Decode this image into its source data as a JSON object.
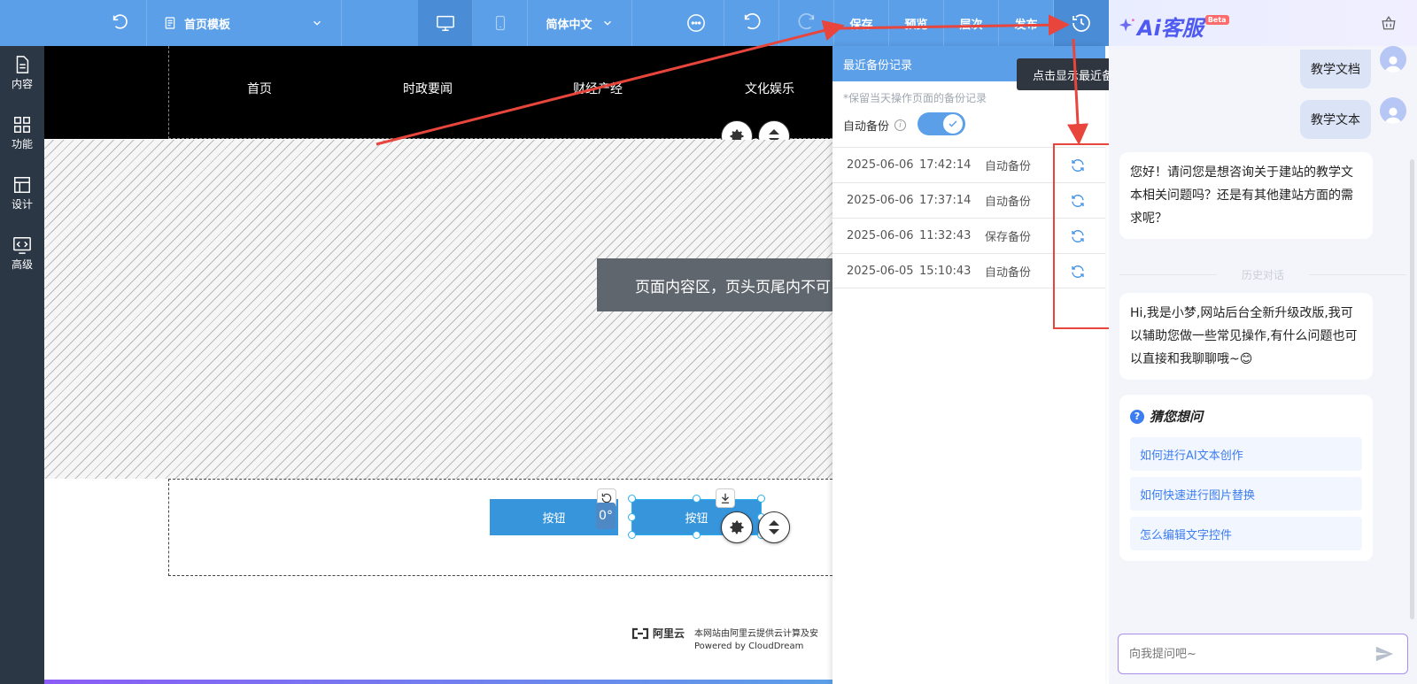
{
  "toolbar": {
    "template_name": "首页模板",
    "language": "简体中文",
    "save": "保存",
    "preview": "预览",
    "layer": "层次",
    "publish": "发布"
  },
  "sidebar": {
    "items": [
      {
        "label": "内容",
        "icon": "document-icon"
      },
      {
        "label": "功能",
        "icon": "grid-icon"
      },
      {
        "label": "设计",
        "icon": "layout-icon"
      },
      {
        "label": "高级",
        "icon": "code-icon"
      }
    ]
  },
  "canvas": {
    "nav": [
      "首页",
      "时政要闻",
      "财经产经",
      "文化娱乐"
    ],
    "content_label": "页面内容区，页头页尾内不可",
    "buttons": [
      "按钮",
      "按钮"
    ],
    "rotation": "0°",
    "footer_logo": "阿里云",
    "footer_line1": "本网站由阿里云提供云计算及安",
    "footer_line2": "Powered by CloudDream"
  },
  "backup": {
    "title": "最近备份记录",
    "note": "*保留当天操作页面的备份记录",
    "auto_label": "自动备份",
    "auto_enabled": true,
    "tooltip": "点击显示最近备份",
    "records": [
      {
        "date": "2025-06-06",
        "time": "17:42:14",
        "kind": "自动备份"
      },
      {
        "date": "2025-06-06",
        "time": "17:37:14",
        "kind": "自动备份"
      },
      {
        "date": "2025-06-06",
        "time": "11:32:43",
        "kind": "保存备份"
      },
      {
        "date": "2025-06-05",
        "time": "15:10:43",
        "kind": "自动备份"
      }
    ]
  },
  "chat": {
    "brand": "Ai客服",
    "beta": "Beta",
    "user_messages": [
      "教学文档",
      "教学文本"
    ],
    "ai_reply": "您好！请问您是想咨询关于建站的教学文本相关问题吗？还是有其他建站方面的需求呢？",
    "history_divider": "历史对话",
    "ai_greeting": "Hi,我是小梦,网站后台全新升级改版,我可以辅助您做一些常见操作,有什么问题也可以直接和我聊聊哦~😊",
    "guess_title": "猜您想问",
    "guess_items": [
      "如何进行AI文本创作",
      "如何快速进行图片替换",
      "怎么编辑文字控件"
    ],
    "input_placeholder": "向我提问吧~"
  },
  "colors": {
    "toolbar_blue": "#5b9fe8",
    "sidebar_dark": "#2c3745",
    "annotation_red": "#e8453c",
    "chat_accent": "#4f5bf0"
  }
}
